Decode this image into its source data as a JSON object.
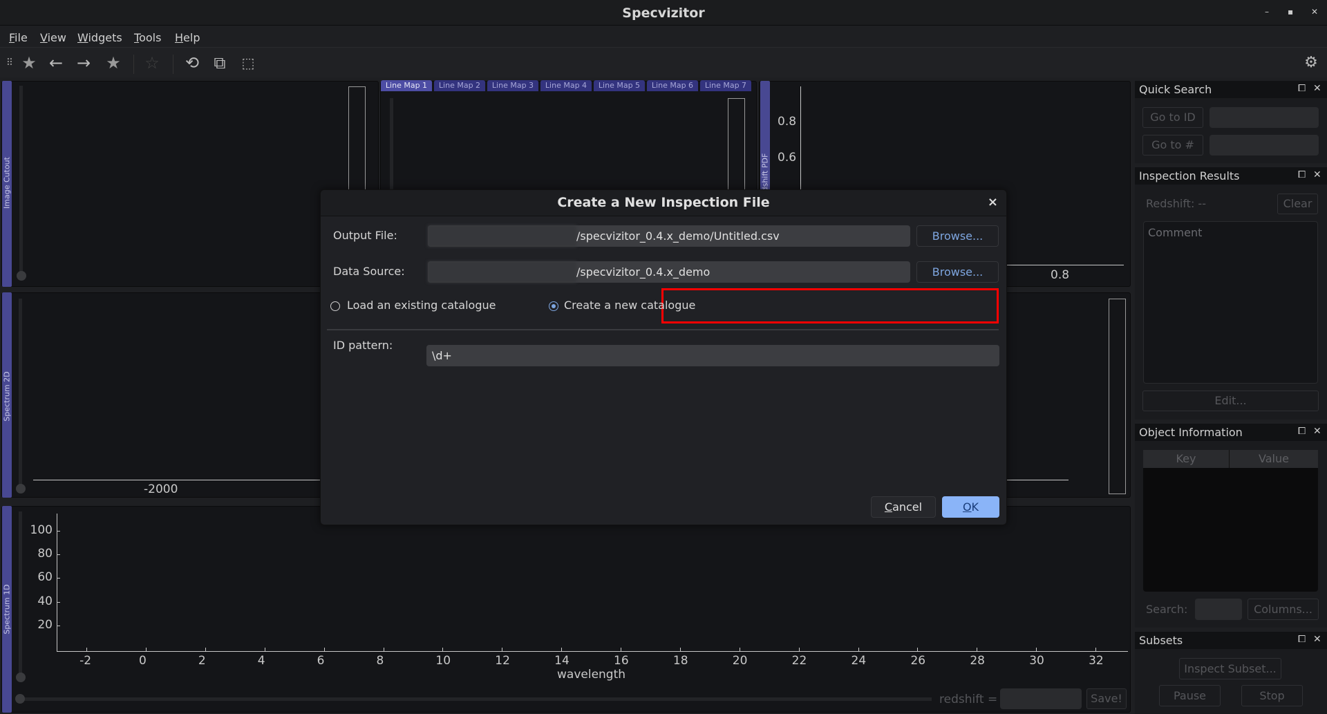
{
  "window": {
    "title": "Specvizitor",
    "controls": [
      "–",
      "▪",
      "✕"
    ]
  },
  "menu": [
    {
      "u": "F",
      "rest": "ile"
    },
    {
      "u": "V",
      "rest": "iew"
    },
    {
      "u": "W",
      "rest": "idgets"
    },
    {
      "u": "T",
      "rest": "ools"
    },
    {
      "u": "H",
      "rest": "elp"
    }
  ],
  "toolbar": {
    "icons": [
      "grip-icon",
      "star-back-icon",
      "back-arrow-icon",
      "forward-arrow-icon",
      "star-forward-icon",
      "star-icon",
      "zoom-reset-icon",
      "reset-view-icon",
      "screenshot-icon",
      "settings-icon"
    ]
  },
  "panels": {
    "image_cutout": {
      "tab": "Image Cutout"
    },
    "line_maps": {
      "tabs": [
        "Line Map 1",
        "Line Map 2",
        "Line Map 3",
        "Line Map 4",
        "Line Map 5",
        "Line Map 6",
        "Line Map 7"
      ],
      "active": 0
    },
    "redshift_pdf": {
      "tab": "Redshift PDF",
      "yticks": [
        "0.8",
        "0.6"
      ],
      "xticks": [
        "0.8"
      ]
    },
    "spectrum_2d": {
      "tab": "Spectrum 2D",
      "xticks": [
        "-2000"
      ]
    },
    "spectrum_1d": {
      "tab": "Spectrum 1D",
      "xlabel": "wavelength",
      "xticks": [
        -2,
        0,
        2,
        4,
        6,
        8,
        10,
        12,
        14,
        16,
        18,
        20,
        22,
        24,
        26,
        28,
        30,
        32
      ],
      "yticks": [
        20,
        40,
        60,
        80,
        100
      ],
      "redshift_label": "redshift =",
      "redshift_value": "",
      "save": "Save!"
    }
  },
  "dock": {
    "quick_search": {
      "title": "Quick Search",
      "go_id": "Go to ID",
      "go_num": "Go to #",
      "id_value": "",
      "num_value": ""
    },
    "inspection": {
      "title": "Inspection Results",
      "redshift": "Redshift: --",
      "clear": "Clear",
      "comment_placeholder": "Comment",
      "edit": "Edit..."
    },
    "object_info": {
      "title": "Object Information",
      "columns": [
        "Key",
        "Value"
      ],
      "search_label": "Search:",
      "search_value": "",
      "columns_btn": "Columns..."
    },
    "subsets": {
      "title": "Subsets",
      "inspect": "Inspect Subset...",
      "pause": "Pause",
      "stop": "Stop"
    }
  },
  "dialog": {
    "title": "Create a New Inspection File",
    "close": "×",
    "output_label": "Output File:",
    "output_value": "/specvizitor_0.4.x_demo/Untitled.csv",
    "source_label": "Data Source:",
    "source_value": "/specvizitor_0.4.x_demo",
    "browse": "Browse...",
    "radio_load": "Load an existing catalogue",
    "radio_create": "Create a new catalogue",
    "selected": "create",
    "id_label": "ID pattern:",
    "id_value": "\\d+",
    "cancel_u": "C",
    "cancel_rest": "ancel",
    "ok_u": "O",
    "ok_rest": "K",
    "highlight_color": "#ff0000",
    "accent": "#7ea6e0"
  }
}
